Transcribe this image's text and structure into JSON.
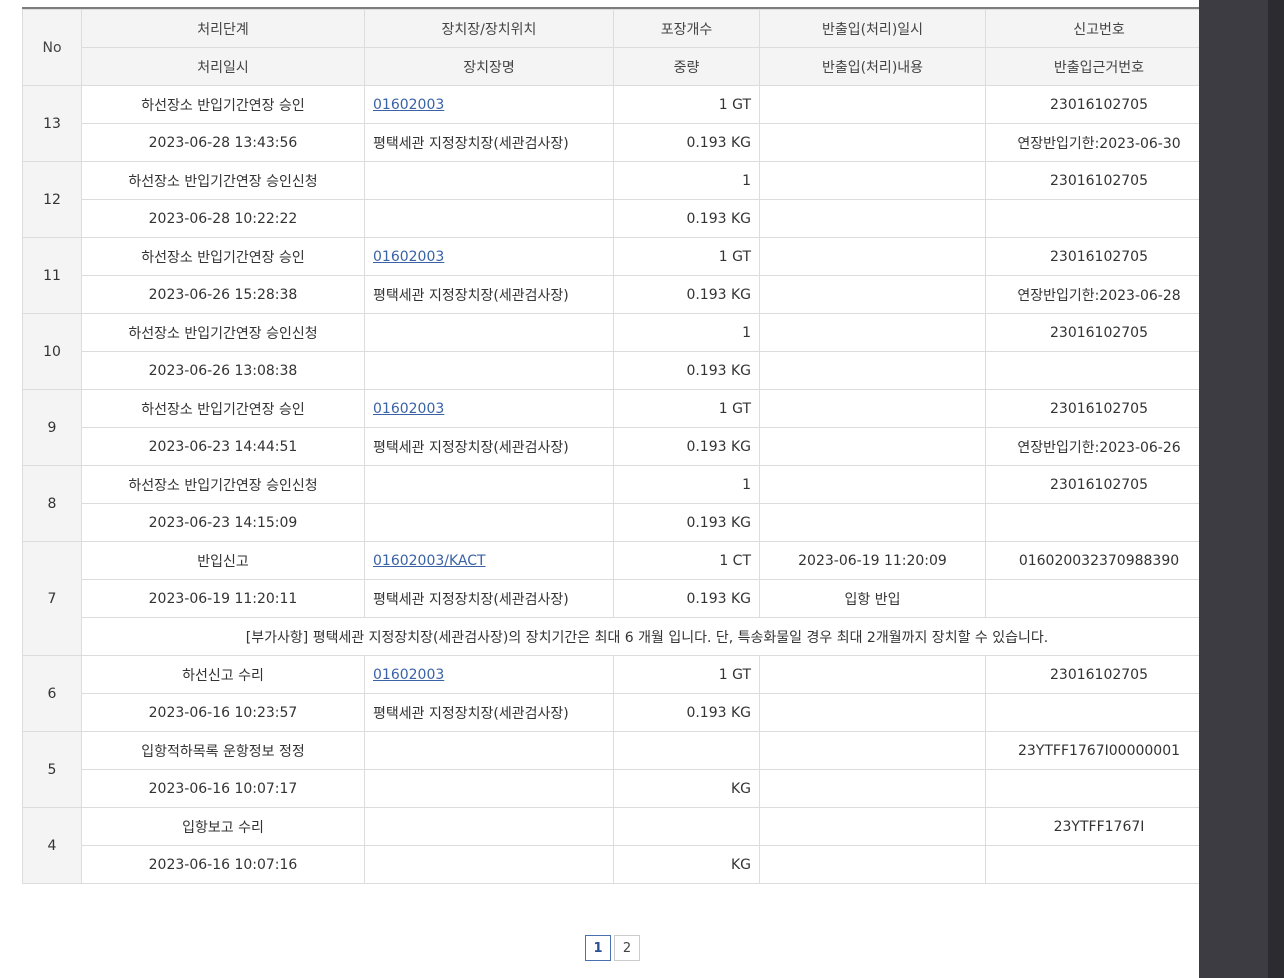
{
  "headers": {
    "row1": [
      "No",
      "처리단계",
      "장치장/장치위치",
      "포장개수",
      "반출입(처리)일시",
      "신고번호"
    ],
    "row2": [
      "처리일시",
      "장치장명",
      "중량",
      "반출입(처리)내용",
      "반출입근거번호"
    ]
  },
  "rows": [
    {
      "no": "13",
      "stage": "하선장소 반입기간연장 승인",
      "location": "01602003",
      "location_link": true,
      "count": "1 GT",
      "io_datetime": "",
      "report_no": "23016102705",
      "datetime": "2023-06-28 13:43:56",
      "name": "평택세관 지정장치장(세관검사장)",
      "weight": "0.193 KG",
      "io_content": "",
      "basis_no": "연장반입기한:2023-06-30"
    },
    {
      "no": "12",
      "stage": "하선장소 반입기간연장 승인신청",
      "location": "",
      "location_link": false,
      "count": "1",
      "io_datetime": "",
      "report_no": "23016102705",
      "datetime": "2023-06-28 10:22:22",
      "name": "",
      "weight": "0.193 KG",
      "io_content": "",
      "basis_no": ""
    },
    {
      "no": "11",
      "stage": "하선장소 반입기간연장 승인",
      "location": "01602003",
      "location_link": true,
      "count": "1 GT",
      "io_datetime": "",
      "report_no": "23016102705",
      "datetime": "2023-06-26 15:28:38",
      "name": "평택세관 지정장치장(세관검사장)",
      "weight": "0.193 KG",
      "io_content": "",
      "basis_no": "연장반입기한:2023-06-28"
    },
    {
      "no": "10",
      "stage": "하선장소 반입기간연장 승인신청",
      "location": "",
      "location_link": false,
      "count": "1",
      "io_datetime": "",
      "report_no": "23016102705",
      "datetime": "2023-06-26 13:08:38",
      "name": "",
      "weight": "0.193 KG",
      "io_content": "",
      "basis_no": ""
    },
    {
      "no": "9",
      "stage": "하선장소 반입기간연장 승인",
      "location": "01602003",
      "location_link": true,
      "count": "1 GT",
      "io_datetime": "",
      "report_no": "23016102705",
      "datetime": "2023-06-23 14:44:51",
      "name": "평택세관 지정장치장(세관검사장)",
      "weight": "0.193 KG",
      "io_content": "",
      "basis_no": "연장반입기한:2023-06-26"
    },
    {
      "no": "8",
      "stage": "하선장소 반입기간연장 승인신청",
      "location": "",
      "location_link": false,
      "count": "1",
      "io_datetime": "",
      "report_no": "23016102705",
      "datetime": "2023-06-23 14:15:09",
      "name": "",
      "weight": "0.193 KG",
      "io_content": "",
      "basis_no": ""
    },
    {
      "no": "7",
      "stage": "반입신고",
      "location": "01602003/KACT",
      "location_link": true,
      "count": "1 CT",
      "io_datetime": "2023-06-19 11:20:09",
      "report_no": "016020032370988390",
      "datetime": "2023-06-19 11:20:11",
      "name": "평택세관 지정장치장(세관검사장)",
      "weight": "0.193 KG",
      "io_content": "입항 반입",
      "basis_no": "",
      "note": "[부가사항] 평택세관 지정장치장(세관검사장)의 장치기간은 최대 6 개월 입니다. 단, 특송화물일 경우 최대 2개월까지 장치할 수 있습니다."
    },
    {
      "no": "6",
      "stage": "하선신고 수리",
      "location": "01602003",
      "location_link": true,
      "count": "1 GT",
      "io_datetime": "",
      "report_no": "23016102705",
      "datetime": "2023-06-16 10:23:57",
      "name": "평택세관 지정장치장(세관검사장)",
      "weight": "0.193 KG",
      "io_content": "",
      "basis_no": ""
    },
    {
      "no": "5",
      "stage": "입항적하목록 운항정보 정정",
      "location": "",
      "location_link": false,
      "count": "",
      "io_datetime": "",
      "report_no": "23YTFF1767I00000001",
      "datetime": "2023-06-16 10:07:17",
      "name": "",
      "weight": "KG",
      "io_content": "",
      "basis_no": ""
    },
    {
      "no": "4",
      "stage": "입항보고 수리",
      "location": "",
      "location_link": false,
      "count": "",
      "io_datetime": "",
      "report_no": "23YTFF1767I",
      "datetime": "2023-06-16 10:07:16",
      "name": "",
      "weight": "KG",
      "io_content": "",
      "basis_no": ""
    }
  ],
  "pagination": {
    "pages": [
      "1",
      "2"
    ],
    "current": "1"
  },
  "colors": {
    "link": "#3a62a7",
    "header_bg": "#f4f4f4",
    "border": "#dcdcdc",
    "side_panel": "#3c3c42"
  }
}
